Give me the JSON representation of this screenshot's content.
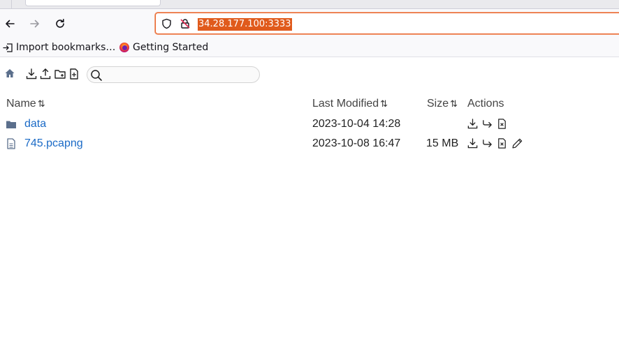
{
  "browser": {
    "url": "34.28.177.100:3333",
    "bookmarks": [
      {
        "label": "Import bookmarks…",
        "icon": "import-icon"
      },
      {
        "label": "Getting Started",
        "icon": "firefox-icon"
      }
    ]
  },
  "toolbar": {
    "icons": [
      "home-icon",
      "download-icon",
      "upload-icon",
      "new-folder-icon",
      "new-file-icon"
    ],
    "search": {
      "value": "",
      "placeholder": ""
    }
  },
  "table": {
    "columns": [
      {
        "label": "Name",
        "sortable": true
      },
      {
        "label": "Last Modified",
        "sortable": true
      },
      {
        "label": "Size",
        "sortable": true
      },
      {
        "label": "Actions",
        "sortable": false
      }
    ],
    "rows": [
      {
        "type": "folder",
        "name": "data",
        "modified": "2023-10-04 14:28",
        "size": "",
        "actions": [
          "download-icon",
          "move-icon",
          "delete-icon"
        ]
      },
      {
        "type": "file",
        "name": "745.pcapng",
        "modified": "2023-10-08 16:47",
        "size": "15 MB",
        "actions": [
          "download-icon",
          "move-icon",
          "delete-icon",
          "edit-icon"
        ]
      }
    ]
  },
  "colors": {
    "link": "#1a6ac6",
    "folder": "#5b6f8c",
    "url_highlight": "#e05a1c",
    "url_border": "#e8632b"
  }
}
